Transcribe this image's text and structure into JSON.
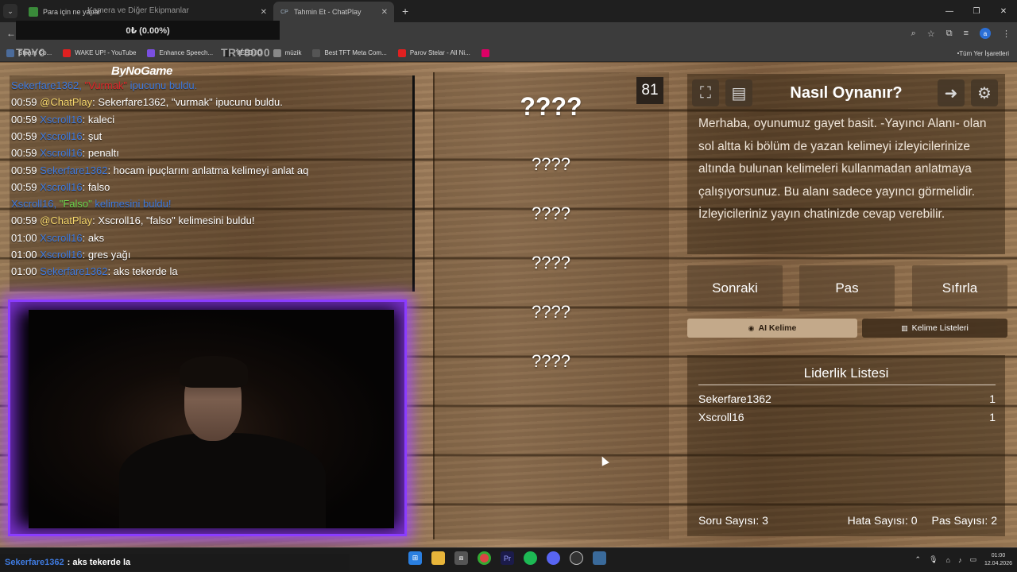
{
  "browser": {
    "tabs": [
      {
        "title": "Para için ne yapar",
        "active": false
      },
      {
        "title": "Tahmin Et - ChatPlay",
        "active": true,
        "favicon": "CP"
      }
    ],
    "tab_overlay_text": "Kamera ve Diğer Ekipmanlar",
    "bookmarks": [
      {
        "label": "Steam Co...",
        "icon": "steam-icon",
        "color": "#4b6b9a"
      },
      {
        "label": "WAKE UP! - YouTube",
        "icon": "youtube-icon",
        "color": "#e02020"
      },
      {
        "label": "Enhance Speech...",
        "icon": "enhance-icon",
        "color": "#7a4fe0"
      },
      {
        "label": "VEED.IO",
        "icon": "veed-icon",
        "color": "#222"
      },
      {
        "label": "müzik",
        "icon": "folder-icon",
        "color": "#888"
      },
      {
        "label": "Best TFT Meta Com...",
        "icon": "tft-icon",
        "color": "#555"
      },
      {
        "label": "Parov Stelar - All Ni...",
        "icon": "youtube-icon",
        "color": "#e02020"
      },
      {
        "label": "",
        "icon": "extra-icon",
        "color": "#d06"
      }
    ],
    "bookmarks_right": "Tüm Yer İşaretleri"
  },
  "overlay": {
    "money": "0₺ (0.00%)",
    "try_left": "TRY0",
    "try_right": "TRY8000",
    "sponsor": "ByNoGame"
  },
  "chat": [
    {
      "time": "",
      "user": "Sekerfare1362",
      "user_color": "blue",
      "parts": [
        {
          "text": ", ",
          "color": "blue"
        },
        {
          "text": "\"Vurmak\"",
          "color": "red"
        },
        {
          "text": " ipucunu buldu.",
          "color": "blue"
        }
      ]
    },
    {
      "time": "00:59",
      "user": "@ChatPlay",
      "user_color": "yellow",
      "parts": [
        {
          "text": ": Sekerfare1362, \"vurmak\" ipucunu buldu.",
          "color": "white"
        }
      ]
    },
    {
      "time": "00:59",
      "user": "Xscroll16",
      "user_color": "blue",
      "parts": [
        {
          "text": ": kaleci",
          "color": "white"
        }
      ]
    },
    {
      "time": "00:59",
      "user": "Xscroll16",
      "user_color": "blue",
      "parts": [
        {
          "text": ": şut",
          "color": "white"
        }
      ]
    },
    {
      "time": "00:59",
      "user": "Xscroll16",
      "user_color": "blue",
      "parts": [
        {
          "text": ": penaltı",
          "color": "white"
        }
      ]
    },
    {
      "time": "00:59",
      "user": "Sekerfare1362",
      "user_color": "blue",
      "parts": [
        {
          "text": ": hocam ipuçlarını anlatma kelimeyi anlat aq",
          "color": "white"
        }
      ]
    },
    {
      "time": "00:59",
      "user": "Xscroll16",
      "user_color": "blue",
      "parts": [
        {
          "text": ": falso",
          "color": "white"
        }
      ]
    },
    {
      "time": "",
      "user": "Xscroll16",
      "user_color": "blue",
      "parts": [
        {
          "text": ", ",
          "color": "blue"
        },
        {
          "text": "\"Falso\"",
          "color": "green"
        },
        {
          "text": " kelimesini buldu!",
          "color": "blue"
        }
      ]
    },
    {
      "time": "00:59",
      "user": "@ChatPlay",
      "user_color": "yellow",
      "parts": [
        {
          "text": ": Xscroll16, \"falso\" kelimesini buldu!",
          "color": "white"
        }
      ]
    },
    {
      "time": "01:00",
      "user": "Xscroll16",
      "user_color": "blue",
      "parts": [
        {
          "text": ": aks",
          "color": "white"
        }
      ]
    },
    {
      "time": "01:00",
      "user": "Xscroll16",
      "user_color": "blue",
      "parts": [
        {
          "text": ": gres yağı",
          "color": "white"
        }
      ]
    },
    {
      "time": "01:00",
      "user": "Sekerfare1362",
      "user_color": "blue",
      "parts": [
        {
          "text": ": aks tekerde la",
          "color": "white"
        }
      ]
    }
  ],
  "game": {
    "timer": "81",
    "main_word": "????",
    "hint_words": [
      "????",
      "????",
      "????",
      "????",
      "????"
    ]
  },
  "howto": {
    "title": "Nasıl Oynanır?",
    "text": "Merhaba, oyunumuz gayet basit. -Yayıncı Alanı- olan sol altta ki bölüm de yazan kelimeyi izleyicilerinize altında bulunan kelimeleri kullanmadan anlatmaya çalışıyorsunuz. Bu alanı sadece yayıncı görmelidir. İzleyicileriniz yayın chatinizde cevap verebilir."
  },
  "actions": {
    "next": "Sonraki",
    "pass": "Pas",
    "reset": "Sıfırla",
    "ai_word": "AI Kelime",
    "word_lists": "Kelime Listeleri"
  },
  "leaderboard": {
    "title": "Liderlik Listesi",
    "rows": [
      {
        "name": "Sekerfare1362",
        "score": "1"
      },
      {
        "name": "Xscroll16",
        "score": "1"
      }
    ],
    "stats": {
      "questions": "Soru Sayısı: 3",
      "errors": "Hata Sayısı: 0",
      "passes": "Pas Sayısı: 2"
    }
  },
  "ticker": {
    "user": "Sekerfare1362",
    "message": ": aks tekerde la"
  },
  "taskbar": {
    "time": "01:00",
    "date": "12.04.2026"
  },
  "colors": {
    "chat_blue": "#3f7be0",
    "chat_red": "#e0262a",
    "chat_yellow": "#f5d66b",
    "chat_green": "#6bd64d",
    "cam_glow": "#8a3cff"
  }
}
